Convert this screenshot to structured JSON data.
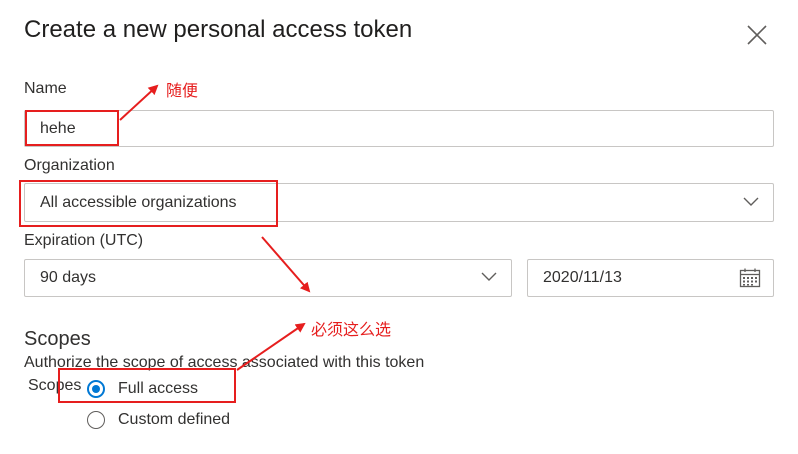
{
  "dialog": {
    "title": "Create a new personal access token"
  },
  "form": {
    "name_label": "Name",
    "name_value": "hehe",
    "organization_label": "Organization",
    "organization_value": "All accessible organizations",
    "expiration_label": "Expiration (UTC)",
    "expiration_value": "90 days",
    "expiration_date": "2020/11/13"
  },
  "scopes": {
    "heading": "Scopes",
    "description": "Authorize the scope of access associated with this token",
    "legend": "Scopes",
    "options": [
      {
        "label": "Full access",
        "selected": true
      },
      {
        "label": "Custom defined",
        "selected": false
      }
    ]
  },
  "annotations": {
    "note_name": "随便",
    "note_scope": "必须这么选",
    "color": "#e61e1e"
  },
  "colors": {
    "accent": "#0078d4",
    "border": "#c8c6c4"
  },
  "icons": [
    "close-icon",
    "chevron-down-icon",
    "calendar-icon"
  ]
}
